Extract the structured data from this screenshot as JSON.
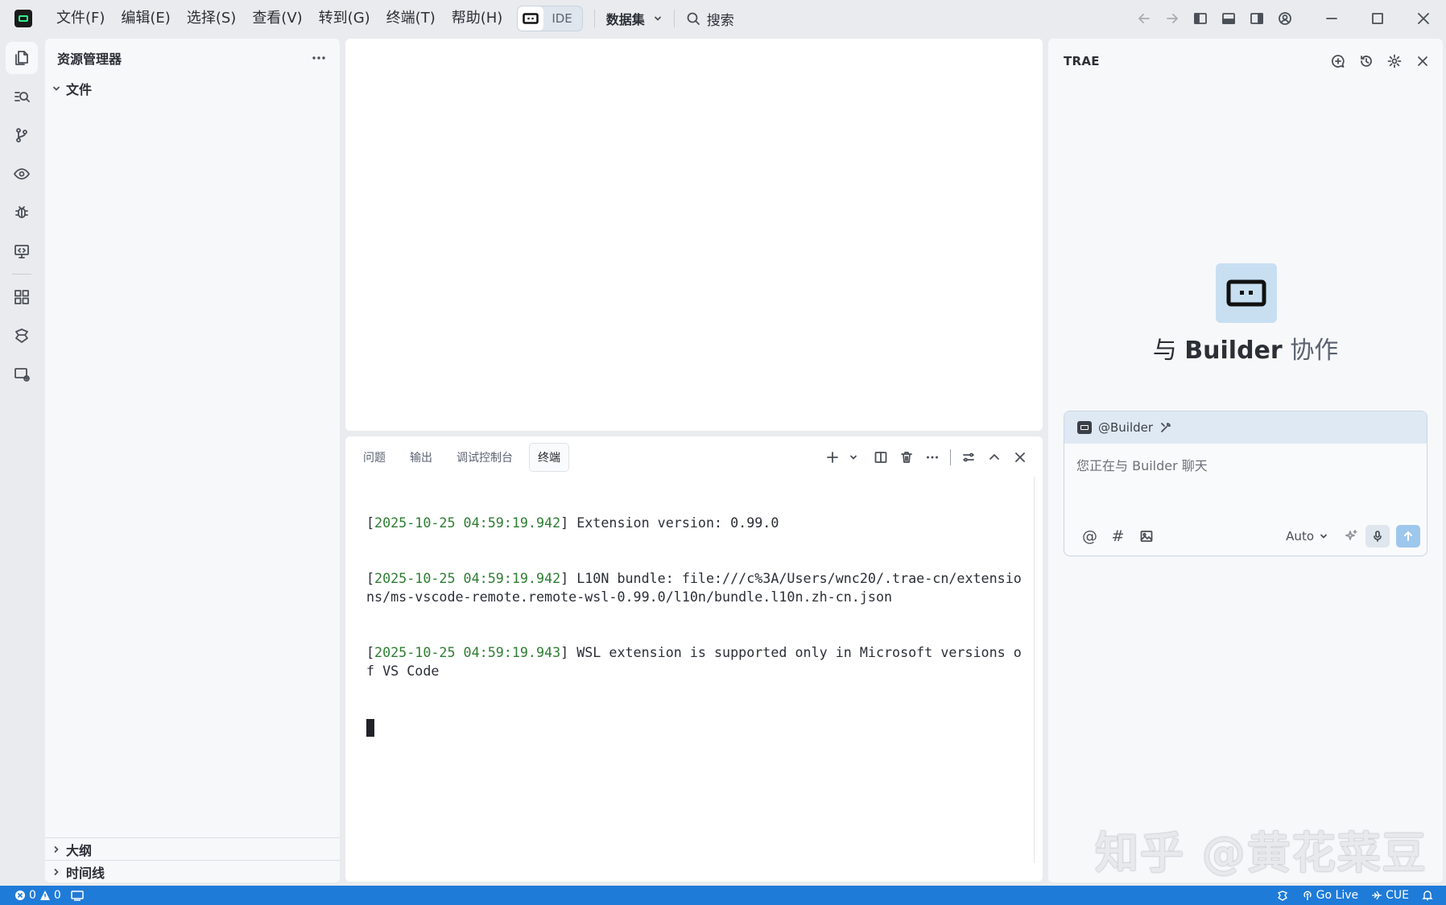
{
  "titlebar": {
    "menus": [
      "文件(F)",
      "编辑(E)",
      "选择(S)",
      "查看(V)",
      "转到(G)",
      "终端(T)",
      "帮助(H)"
    ],
    "mode_ide_label": "IDE",
    "dataset_label": "数据集",
    "search_label": "搜索"
  },
  "explorer": {
    "title": "资源管理器",
    "root_folder": "文件",
    "sections": [
      "大纲",
      "时间线"
    ]
  },
  "panel": {
    "tabs": [
      "问题",
      "输出",
      "调试控制台",
      "终端"
    ],
    "active_tab": "终端",
    "terminal_lines": [
      {
        "ts": "2025-10-25 04:59:19.942",
        "text": "Extension version: 0.99.0"
      },
      {
        "ts": "2025-10-25 04:59:19.942",
        "text": "L10N bundle: file:///c%3A/Users/wnc20/.trae-cn/extensions/ms-vscode-remote.remote-wsl-0.99.0/l10n/bundle.l10n.zh-cn.json"
      },
      {
        "ts": "2025-10-25 04:59:19.943",
        "text": "WSL extension is supported only in Microsoft versions of VS Code"
      }
    ]
  },
  "chat": {
    "title": "TRAE",
    "hero_prefix": "与 ",
    "hero_agent": "Builder",
    "hero_suffix": " 协作",
    "mention": "@Builder",
    "placeholder": "您正在与 Builder 聊天",
    "model_select": "Auto",
    "toolbar_at": "@",
    "toolbar_hash": "#"
  },
  "watermark": "知乎 @黄花菜豆",
  "statusbar": {
    "errors": "0",
    "warnings": "0",
    "go_live": "Go Live",
    "cue": "CUE"
  },
  "colors": {
    "accent": "#1f7bd8",
    "timestamp_green": "#2e7d32",
    "send_button": "#9dc7ec"
  }
}
